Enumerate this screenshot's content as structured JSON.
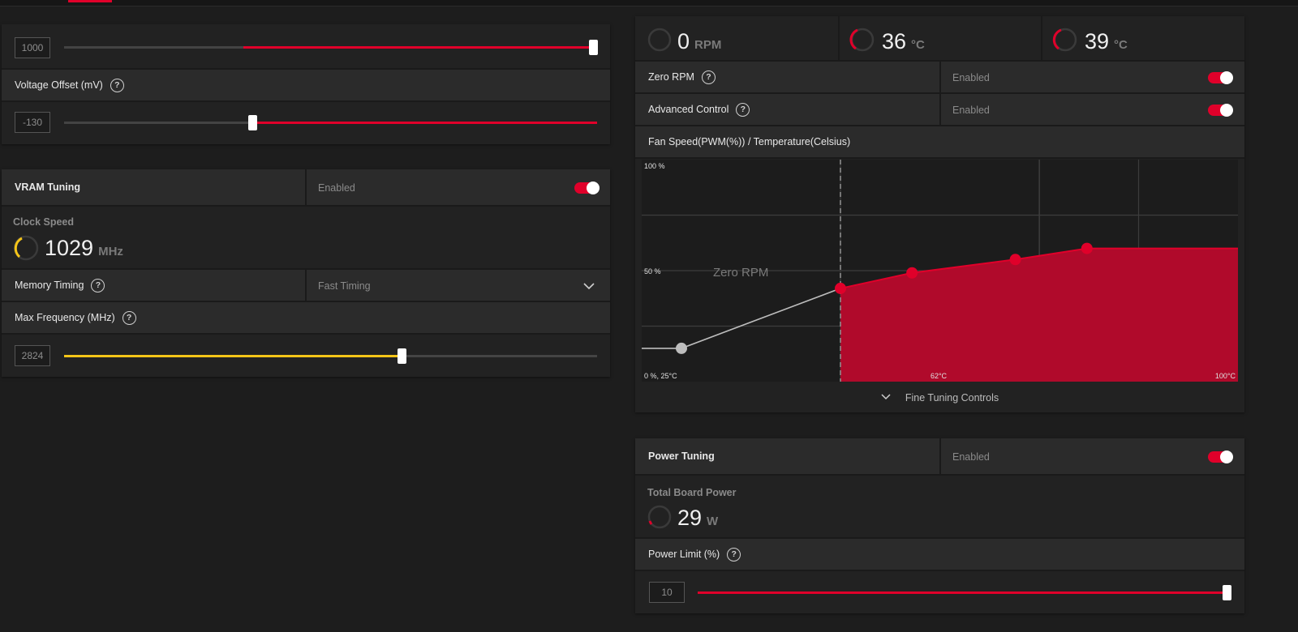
{
  "colors": {
    "accent": "#e0002a",
    "yellow": "#f5c518",
    "fill": "#b00a2b"
  },
  "gpu_panel": {
    "top_slider": {
      "value": "1000",
      "fraction": 1.0
    },
    "voltage": {
      "label": "Voltage Offset (mV)",
      "value": "-130",
      "fraction": 0.35
    }
  },
  "vram": {
    "title": "VRAM Tuning",
    "state": "Enabled",
    "clock_title": "Clock Speed",
    "clock_value": "1029",
    "clock_unit": "MHz",
    "memory_timing_label": "Memory Timing",
    "memory_timing_value": "Fast Timing",
    "max_freq_label": "Max Frequency (MHz)",
    "max_freq_value": "2824",
    "max_freq_fraction": 0.63
  },
  "fan": {
    "rpm_value": "0",
    "rpm_unit": "RPM",
    "temp1_value": "36",
    "temp1_unit": "°C",
    "temp2_value": "39",
    "temp2_unit": "°C",
    "zero_rpm_label": "Zero RPM",
    "zero_rpm_state": "Enabled",
    "adv_label": "Advanced Control",
    "adv_state": "Enabled",
    "chart_title": "Fan Speed(PWM(%)) / Temperature(Celsius)",
    "fine_tuning_label": "Fine Tuning Controls"
  },
  "chart_data": {
    "type": "area",
    "xlim": [
      25,
      100
    ],
    "ylim": [
      0,
      100
    ],
    "labels": {
      "y_top": "100 %",
      "y_mid": "50 %",
      "origin": "0 %, 25°C",
      "x_mid": "62°C",
      "x_max": "100°C"
    },
    "annotation": "Zero RPM",
    "zero_rpm_temp": 62,
    "zero_rpm_points": [
      {
        "x": 25,
        "y": 15
      },
      {
        "x": 30,
        "y": 15
      },
      {
        "x": 50,
        "y": 42
      }
    ],
    "points": [
      {
        "x": 50,
        "y": 42
      },
      {
        "x": 59,
        "y": 49
      },
      {
        "x": 72,
        "y": 55
      },
      {
        "x": 81,
        "y": 60
      }
    ],
    "tail": {
      "x": 100,
      "y": 60
    }
  },
  "power": {
    "title": "Power Tuning",
    "state": "Enabled",
    "tbp_title": "Total Board Power",
    "tbp_value": "29",
    "tbp_unit": "W",
    "limit_label": "Power Limit (%)",
    "limit_value": "10",
    "limit_fraction": 1.0
  }
}
